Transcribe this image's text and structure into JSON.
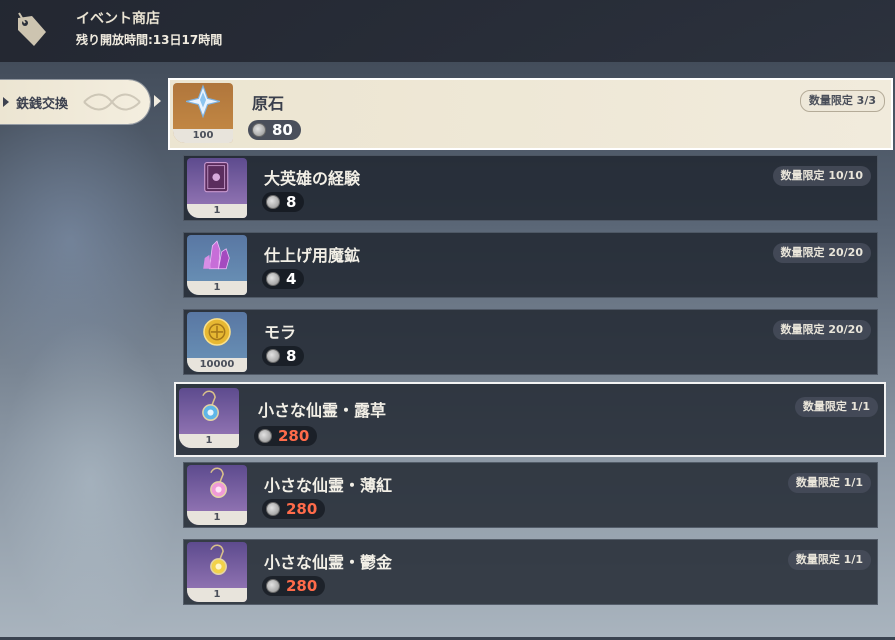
{
  "header": {
    "title": "イベント商店",
    "subtitle": "残り開放時間:13日17時間",
    "icon": "price-tag-icon"
  },
  "sidebar": {
    "tabs": [
      {
        "label": "鉄銭交換",
        "selected": true
      }
    ]
  },
  "currency_icon": "iron-coin-icon",
  "items": [
    {
      "name": "原石",
      "qty": "100",
      "price": "80",
      "limit": "数量限定 3/3",
      "icon": "primogem-icon",
      "affordable": true,
      "state": "highlighted"
    },
    {
      "name": "大英雄の経験",
      "qty": "1",
      "price": "8",
      "limit": "数量限定 10/10",
      "icon": "hero-wit-book-icon",
      "affordable": true,
      "state": "normal"
    },
    {
      "name": "仕上げ用魔鉱",
      "qty": "1",
      "price": "4",
      "limit": "数量限定 20/20",
      "icon": "mystic-ore-icon",
      "affordable": true,
      "state": "normal"
    },
    {
      "name": "モラ",
      "qty": "10000",
      "price": "8",
      "limit": "数量限定 20/20",
      "icon": "mora-coin-icon",
      "affordable": true,
      "state": "normal"
    },
    {
      "name": "小さな仙霊・露草",
      "qty": "1",
      "price": "280",
      "limit": "数量限定 1/1",
      "icon": "seelie-blue-icon",
      "affordable": false,
      "state": "selected"
    },
    {
      "name": "小さな仙霊・薄紅",
      "qty": "1",
      "price": "280",
      "limit": "数量限定 1/1",
      "icon": "seelie-pink-icon",
      "affordable": false,
      "state": "normal"
    },
    {
      "name": "小さな仙霊・鬱金",
      "qty": "1",
      "price": "280",
      "limit": "数量限定 1/1",
      "icon": "seelie-gold-icon",
      "affordable": false,
      "state": "normal"
    }
  ]
}
